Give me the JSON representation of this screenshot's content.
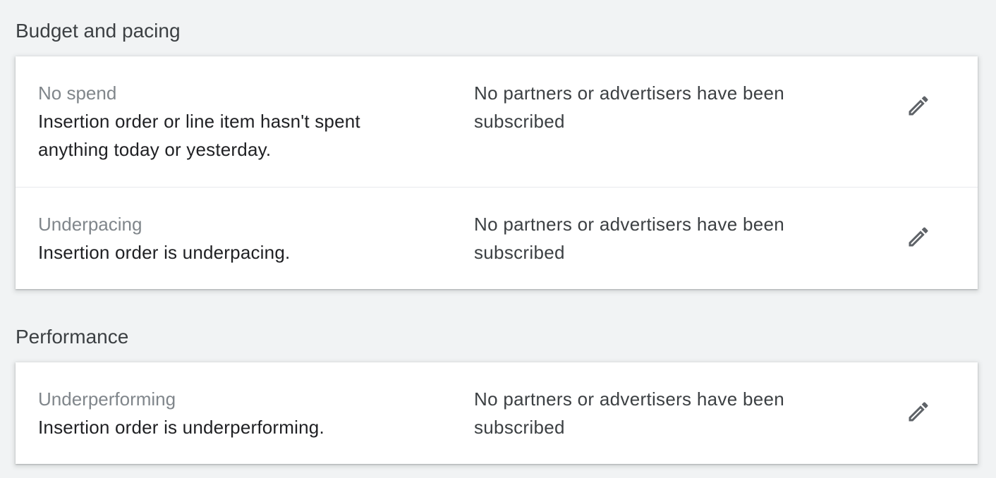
{
  "sections": [
    {
      "title": "Budget and pacing",
      "alerts": [
        {
          "name": "No spend",
          "description": "Insertion order or line item hasn't spent anything today or yesterday.",
          "subscription_status": "No partners or advertisers have been subscribed",
          "action_icon": "edit-pencil-icon"
        },
        {
          "name": "Underpacing",
          "description": "Insertion order is underpacing.",
          "subscription_status": "No partners or advertisers have been subscribed",
          "action_icon": "edit-pencil-icon"
        }
      ]
    },
    {
      "title": "Performance",
      "alerts": [
        {
          "name": "Underperforming",
          "description": "Insertion order is underperforming.",
          "subscription_status": "No partners or advertisers have been subscribed",
          "action_icon": "edit-pencil-icon"
        }
      ]
    }
  ],
  "colors": {
    "background": "#f1f3f4",
    "card": "#ffffff",
    "alert_name": "#80868b",
    "alert_description": "#202124",
    "section_title": "#3c4043",
    "icon": "#5f6368"
  }
}
